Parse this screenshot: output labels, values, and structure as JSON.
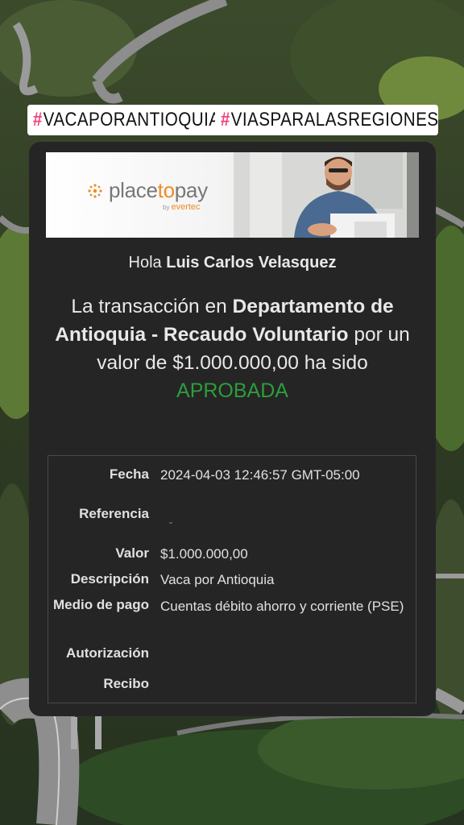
{
  "hashtags": [
    "VACAPORANTIOQUIA",
    "VIASPARALASREGIONES"
  ],
  "hash_symbol": "#",
  "banner": {
    "logo_main_a": "place",
    "logo_main_b": "to",
    "logo_main_c": "pay",
    "logo_by": "by",
    "logo_sub": "evertec"
  },
  "greeting": {
    "prefix": "Hola",
    "name": "Luis Carlos Velasquez"
  },
  "message": {
    "part1": "La transacción en ",
    "merchant": "Departamento de Antioquia - Recaudo Voluntario",
    "part2": " por un valor de $1.000.000,00 ha sido",
    "status": "APROBADA"
  },
  "details": [
    {
      "label": "Fecha",
      "value": "2024-04-03 12:46:57 GMT-05:00"
    },
    {
      "label": "Referencia",
      "value": ""
    },
    {
      "label": "Valor",
      "value": "$1.000.000,00"
    },
    {
      "label": "Descripción",
      "value": "Vaca por Antioquia"
    },
    {
      "label": "Medio de pago",
      "value": "Cuentas débito ahorro y corriente (PSE)"
    },
    {
      "label": "Autorización",
      "value": ""
    },
    {
      "label": "Recibo",
      "value": ""
    }
  ],
  "colors": {
    "status_green": "#2d9d3a",
    "card_bg": "#252526",
    "brand_orange": "#f08a28",
    "hashtag_pink": "#f0447a"
  }
}
